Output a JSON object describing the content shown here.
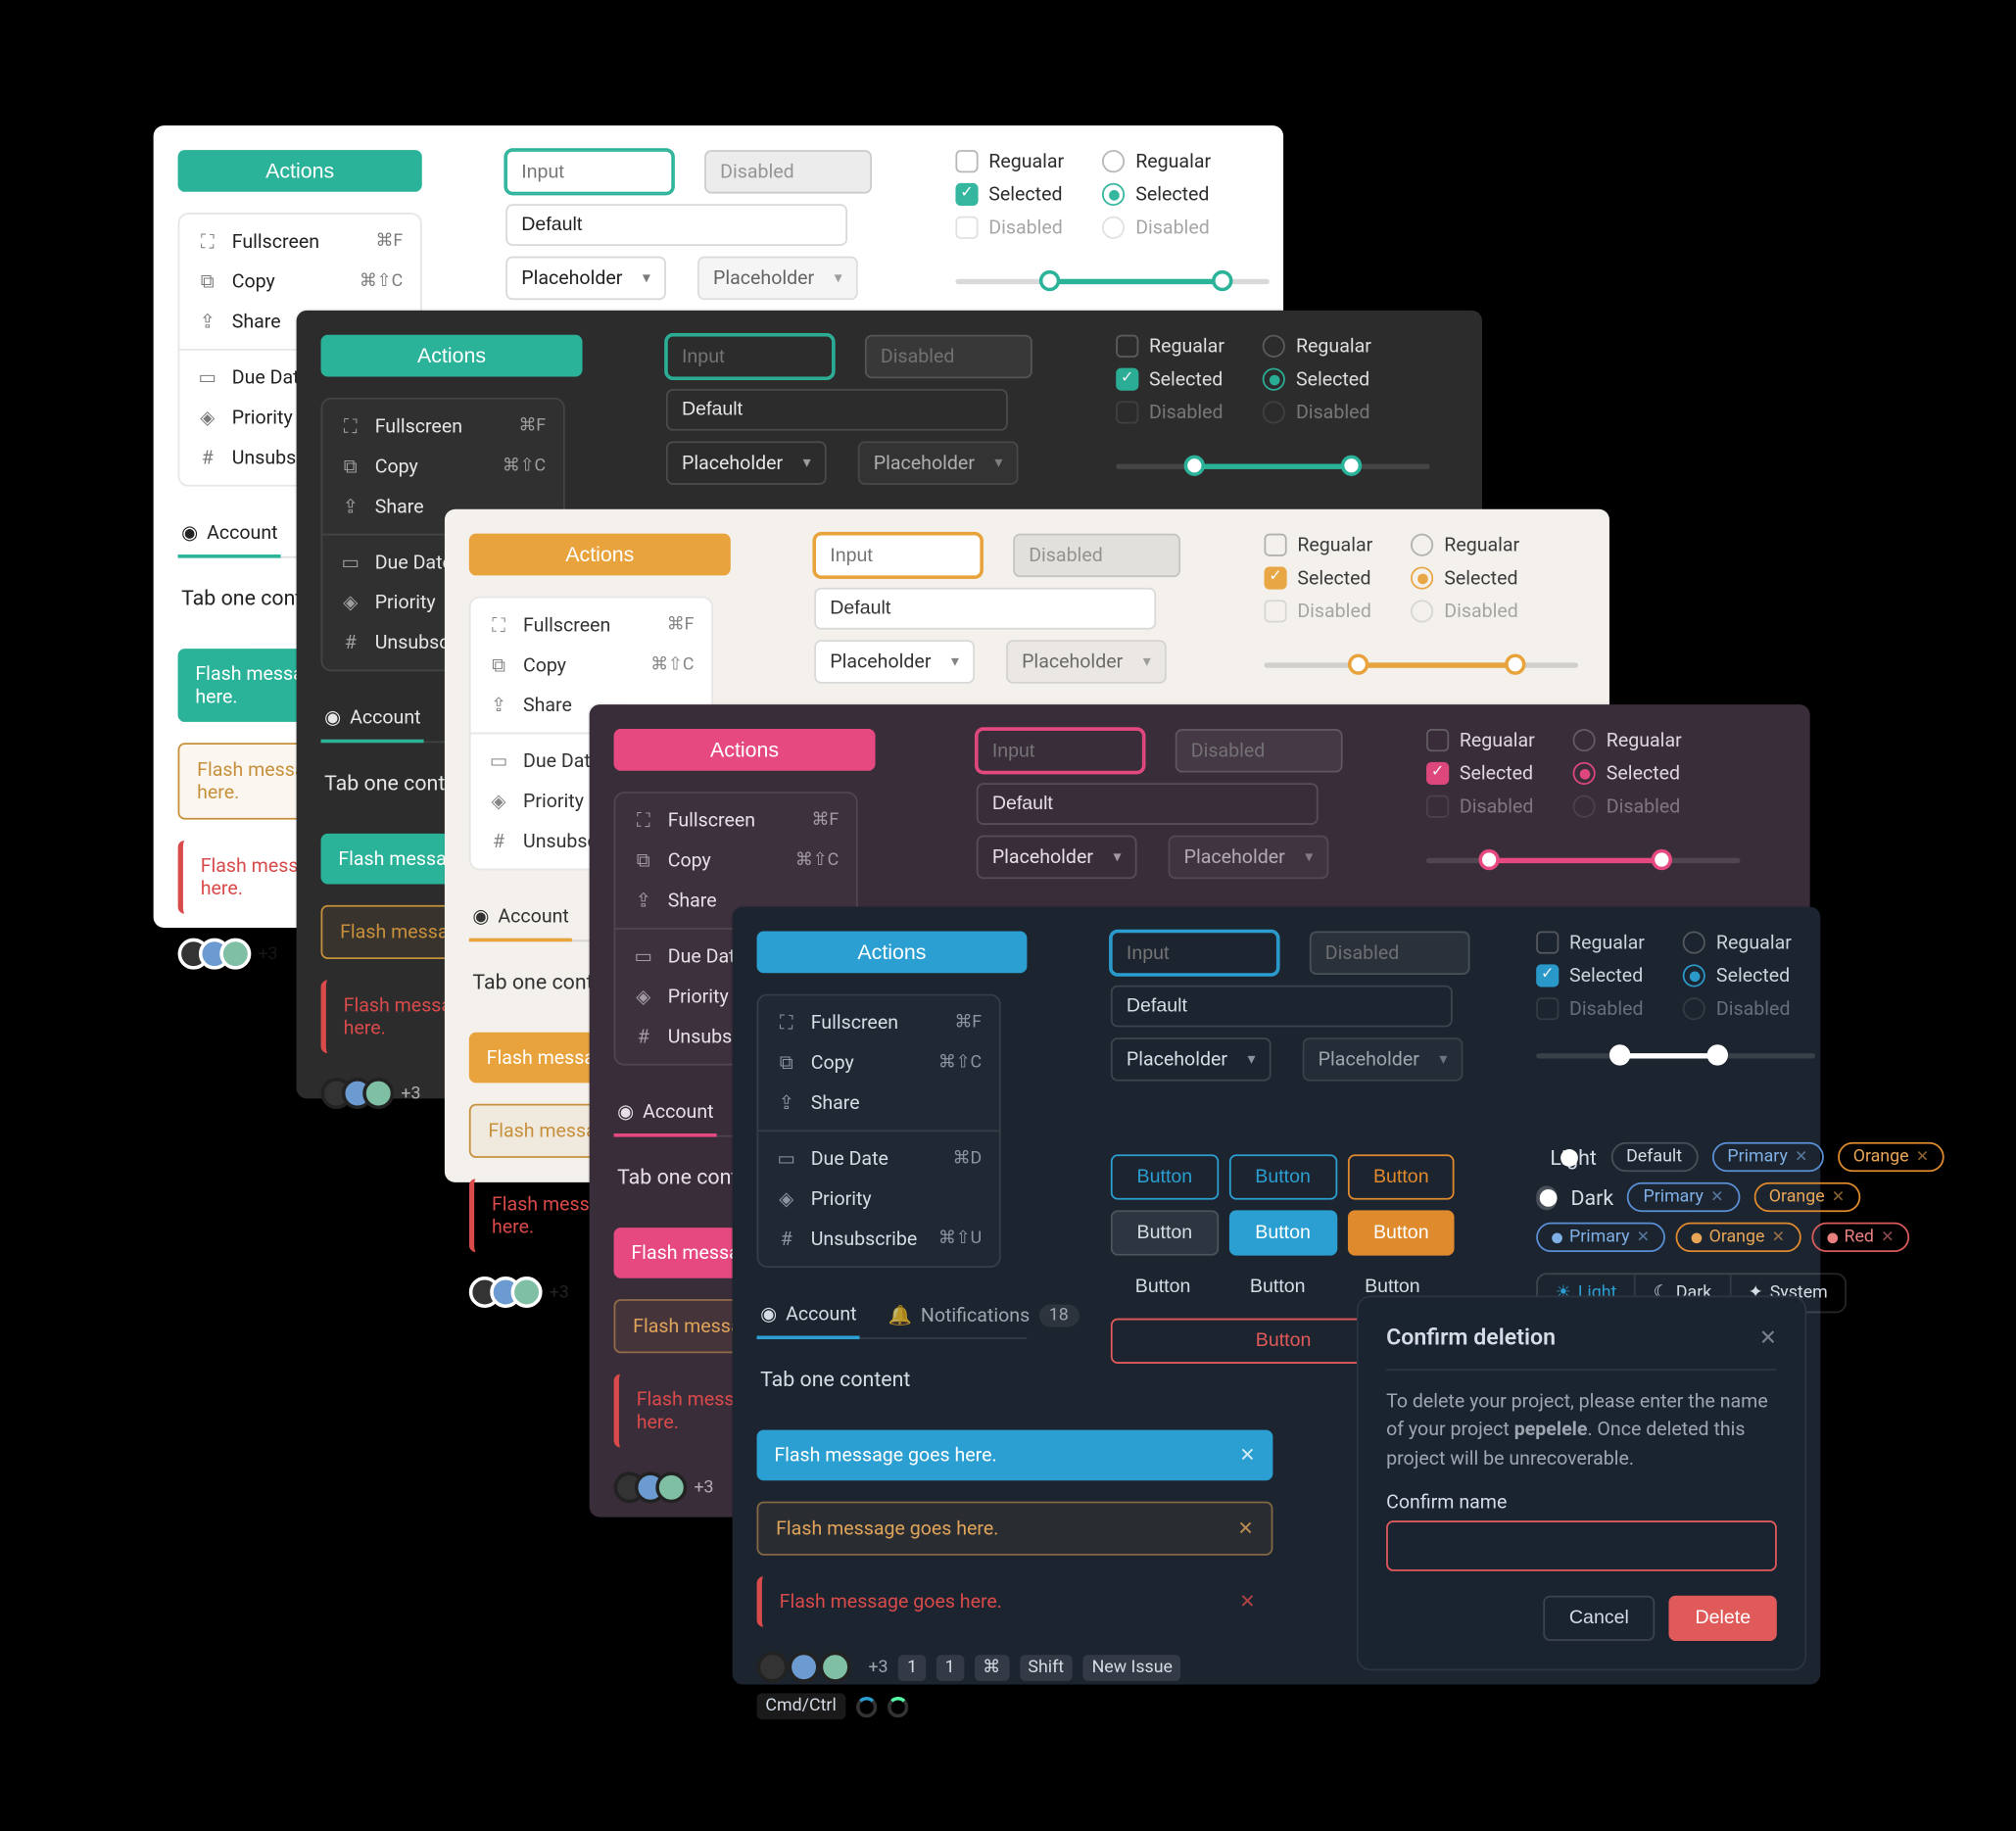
{
  "actions_label": "Actions",
  "menu": {
    "fullscreen": "Fullscreen",
    "fullscreen_kbd": "⌘F",
    "copy": "Copy",
    "copy_kbd": "⌘⇧C",
    "share": "Share",
    "due_date": "Due Date",
    "due_date_kbd": "⌘D",
    "priority": "Priority",
    "unsubscribe": "Unsubscribe",
    "unsubscribe_kbd": "⌘⇧U"
  },
  "inputs": {
    "focused_placeholder": "Input",
    "disabled_label": "Disabled",
    "default_value": "Default",
    "select_placeholder": "Placeholder"
  },
  "options": {
    "regular": "Regualar",
    "selected": "Selected",
    "disabled": "Disabled"
  },
  "tabs": {
    "account": "Account",
    "notifications": "Notifications",
    "notif_count": "18",
    "content": "Tab one content"
  },
  "flash": {
    "msg": "Flash message goes here."
  },
  "avatars_plus": "+3",
  "buttons_label": "Button",
  "toggle": {
    "light": "Light",
    "dark": "Dark"
  },
  "chips": {
    "default": "Default",
    "primary": "Primary",
    "orange": "Orange",
    "red": "Red"
  },
  "seg": {
    "light": "Light",
    "dark": "Dark",
    "system": "System"
  },
  "chipsrow": {
    "one": "1"
  },
  "kbds": {
    "cmd": "⌘",
    "shift": "Shift",
    "new_issue": "New Issue",
    "cmdctrl": "Cmd/Ctrl"
  },
  "modal": {
    "title": "Confirm deletion",
    "body_pre": "To delete your project, please enter the name of your project ",
    "project": "pepelele",
    "body_post": ". Once deleted this project will be unrecoverable.",
    "confirm_label": "Confirm name",
    "cancel": "Cancel",
    "delete": "Delete"
  }
}
